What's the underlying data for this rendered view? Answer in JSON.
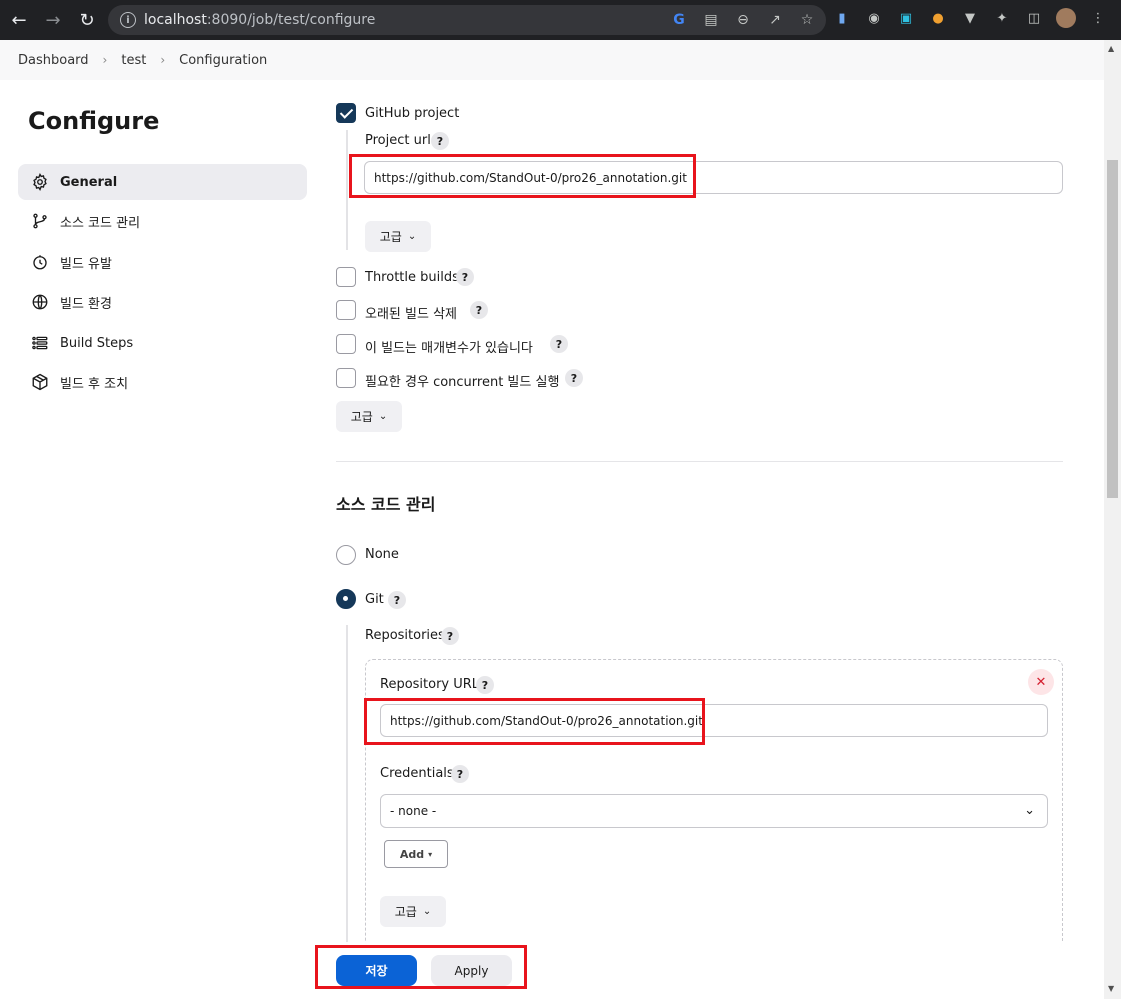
{
  "browser": {
    "url_host": "localhost",
    "url_rest": ":8090/job/test/configure"
  },
  "breadcrumb": {
    "items": [
      "Dashboard",
      "test",
      "Configuration"
    ]
  },
  "sidebar": {
    "title": "Configure",
    "items": [
      {
        "label": "General",
        "icon": "gear-icon",
        "active": true
      },
      {
        "label": "소스 코드 관리",
        "icon": "branch-icon",
        "active": false
      },
      {
        "label": "빌드 유발",
        "icon": "timer-icon",
        "active": false
      },
      {
        "label": "빌드 환경",
        "icon": "globe-icon",
        "active": false
      },
      {
        "label": "Build Steps",
        "icon": "list-icon",
        "active": false
      },
      {
        "label": "빌드 후 조치",
        "icon": "package-icon",
        "active": false
      }
    ]
  },
  "general": {
    "github_project": {
      "label": "GitHub project",
      "checked": true
    },
    "project_url_label": "Project url",
    "project_url_value": "https://github.com/StandOut-0/pro26_annotation.git",
    "advanced_label": "고급",
    "options": [
      {
        "label": "Throttle builds",
        "checked": false
      },
      {
        "label": "오래된 빌드 삭제",
        "checked": false
      },
      {
        "label": "이 빌드는 매개변수가 있습니다",
        "checked": false
      },
      {
        "label": "필요한 경우 concurrent 빌드 실행",
        "checked": false
      }
    ],
    "advanced_label_2": "고급"
  },
  "scm": {
    "title": "소스 코드 관리",
    "options": [
      {
        "label": "None",
        "selected": false
      },
      {
        "label": "Git",
        "selected": true
      }
    ],
    "repositories_label": "Repositories",
    "repository_url_label": "Repository URL",
    "repository_url_value": "https://github.com/StandOut-0/pro26_annotation.git",
    "credentials_label": "Credentials",
    "credentials_value": "- none -",
    "add_label": "Add",
    "advanced_label": "고급"
  },
  "footer": {
    "save_label": "저장",
    "apply_label": "Apply"
  },
  "help_glyph": "?",
  "colors": {
    "accent": "#0b63d6",
    "checked": "#153859",
    "highlight": "#e8141c"
  }
}
